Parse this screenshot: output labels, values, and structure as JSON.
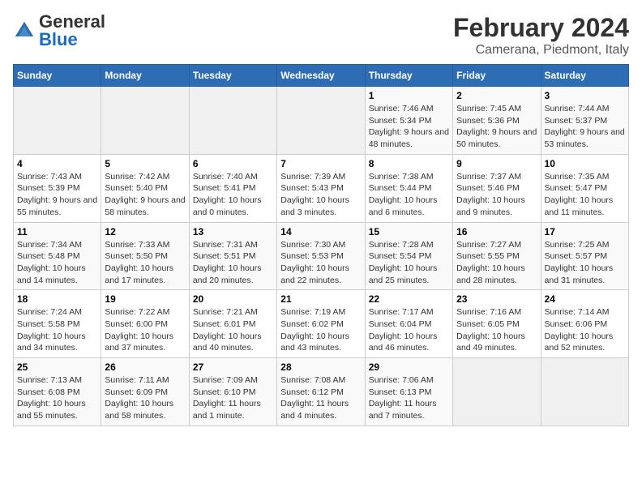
{
  "header": {
    "logo_general": "General",
    "logo_blue": "Blue",
    "title": "February 2024",
    "subtitle": "Camerana, Piedmont, Italy"
  },
  "calendar": {
    "days_of_week": [
      "Sunday",
      "Monday",
      "Tuesday",
      "Wednesday",
      "Thursday",
      "Friday",
      "Saturday"
    ],
    "weeks": [
      [
        {
          "day": "",
          "info": ""
        },
        {
          "day": "",
          "info": ""
        },
        {
          "day": "",
          "info": ""
        },
        {
          "day": "",
          "info": ""
        },
        {
          "day": "1",
          "info": "Sunrise: 7:46 AM\nSunset: 5:34 PM\nDaylight: 9 hours and 48 minutes."
        },
        {
          "day": "2",
          "info": "Sunrise: 7:45 AM\nSunset: 5:36 PM\nDaylight: 9 hours and 50 minutes."
        },
        {
          "day": "3",
          "info": "Sunrise: 7:44 AM\nSunset: 5:37 PM\nDaylight: 9 hours and 53 minutes."
        }
      ],
      [
        {
          "day": "4",
          "info": "Sunrise: 7:43 AM\nSunset: 5:39 PM\nDaylight: 9 hours and 55 minutes."
        },
        {
          "day": "5",
          "info": "Sunrise: 7:42 AM\nSunset: 5:40 PM\nDaylight: 9 hours and 58 minutes."
        },
        {
          "day": "6",
          "info": "Sunrise: 7:40 AM\nSunset: 5:41 PM\nDaylight: 10 hours and 0 minutes."
        },
        {
          "day": "7",
          "info": "Sunrise: 7:39 AM\nSunset: 5:43 PM\nDaylight: 10 hours and 3 minutes."
        },
        {
          "day": "8",
          "info": "Sunrise: 7:38 AM\nSunset: 5:44 PM\nDaylight: 10 hours and 6 minutes."
        },
        {
          "day": "9",
          "info": "Sunrise: 7:37 AM\nSunset: 5:46 PM\nDaylight: 10 hours and 9 minutes."
        },
        {
          "day": "10",
          "info": "Sunrise: 7:35 AM\nSunset: 5:47 PM\nDaylight: 10 hours and 11 minutes."
        }
      ],
      [
        {
          "day": "11",
          "info": "Sunrise: 7:34 AM\nSunset: 5:48 PM\nDaylight: 10 hours and 14 minutes."
        },
        {
          "day": "12",
          "info": "Sunrise: 7:33 AM\nSunset: 5:50 PM\nDaylight: 10 hours and 17 minutes."
        },
        {
          "day": "13",
          "info": "Sunrise: 7:31 AM\nSunset: 5:51 PM\nDaylight: 10 hours and 20 minutes."
        },
        {
          "day": "14",
          "info": "Sunrise: 7:30 AM\nSunset: 5:53 PM\nDaylight: 10 hours and 22 minutes."
        },
        {
          "day": "15",
          "info": "Sunrise: 7:28 AM\nSunset: 5:54 PM\nDaylight: 10 hours and 25 minutes."
        },
        {
          "day": "16",
          "info": "Sunrise: 7:27 AM\nSunset: 5:55 PM\nDaylight: 10 hours and 28 minutes."
        },
        {
          "day": "17",
          "info": "Sunrise: 7:25 AM\nSunset: 5:57 PM\nDaylight: 10 hours and 31 minutes."
        }
      ],
      [
        {
          "day": "18",
          "info": "Sunrise: 7:24 AM\nSunset: 5:58 PM\nDaylight: 10 hours and 34 minutes."
        },
        {
          "day": "19",
          "info": "Sunrise: 7:22 AM\nSunset: 6:00 PM\nDaylight: 10 hours and 37 minutes."
        },
        {
          "day": "20",
          "info": "Sunrise: 7:21 AM\nSunset: 6:01 PM\nDaylight: 10 hours and 40 minutes."
        },
        {
          "day": "21",
          "info": "Sunrise: 7:19 AM\nSunset: 6:02 PM\nDaylight: 10 hours and 43 minutes."
        },
        {
          "day": "22",
          "info": "Sunrise: 7:17 AM\nSunset: 6:04 PM\nDaylight: 10 hours and 46 minutes."
        },
        {
          "day": "23",
          "info": "Sunrise: 7:16 AM\nSunset: 6:05 PM\nDaylight: 10 hours and 49 minutes."
        },
        {
          "day": "24",
          "info": "Sunrise: 7:14 AM\nSunset: 6:06 PM\nDaylight: 10 hours and 52 minutes."
        }
      ],
      [
        {
          "day": "25",
          "info": "Sunrise: 7:13 AM\nSunset: 6:08 PM\nDaylight: 10 hours and 55 minutes."
        },
        {
          "day": "26",
          "info": "Sunrise: 7:11 AM\nSunset: 6:09 PM\nDaylight: 10 hours and 58 minutes."
        },
        {
          "day": "27",
          "info": "Sunrise: 7:09 AM\nSunset: 6:10 PM\nDaylight: 11 hours and 1 minute."
        },
        {
          "day": "28",
          "info": "Sunrise: 7:08 AM\nSunset: 6:12 PM\nDaylight: 11 hours and 4 minutes."
        },
        {
          "day": "29",
          "info": "Sunrise: 7:06 AM\nSunset: 6:13 PM\nDaylight: 11 hours and 7 minutes."
        },
        {
          "day": "",
          "info": ""
        },
        {
          "day": "",
          "info": ""
        }
      ]
    ]
  }
}
